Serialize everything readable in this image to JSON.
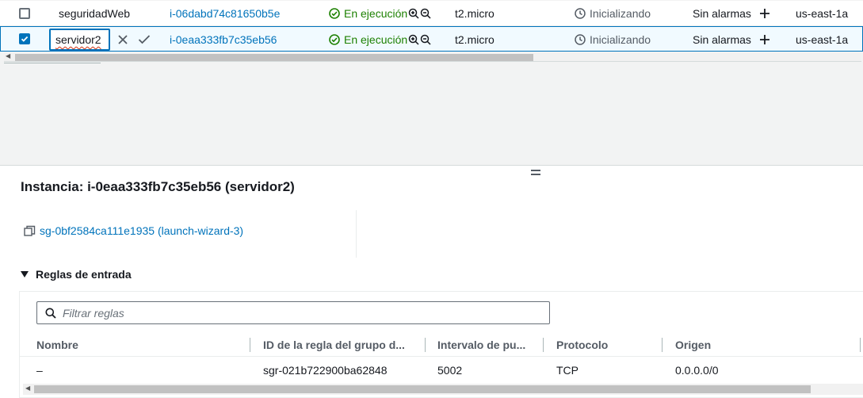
{
  "instances": [
    {
      "name": "seguridadWeb",
      "id": "i-06dabd74c81650b5e",
      "state": "En ejecución",
      "type": "t2.micro",
      "status_check": "Inicializando",
      "alarms": "Sin alarmas",
      "az": "us-east-1a",
      "selected": false
    },
    {
      "name": "servidor2",
      "id": "i-0eaa333fb7c35eb56",
      "state": "En ejecución",
      "type": "t2.micro",
      "status_check": "Inicializando",
      "alarms": "Sin alarmas",
      "az": "us-east-1a",
      "selected": true
    }
  ],
  "details": {
    "title": "Instancia: i-0eaa333fb7c35eb56 (servidor2)",
    "security_group_link": "sg-0bf2584ca111e1935 (launch-wizard-3)",
    "section_title": "Reglas de entrada",
    "filter_placeholder": "Filtrar reglas",
    "columns": [
      "Nombre",
      "ID de la regla del grupo d...",
      "Intervalo de pu...",
      "Protocolo",
      "Origen"
    ],
    "rows": [
      [
        "–",
        "sgr-021b722900ba62848",
        "5002",
        "TCP",
        "0.0.0.0/0"
      ]
    ]
  },
  "colors": {
    "link": "#0073bb",
    "running": "#1d8102",
    "selected_row_bg": "#f1faff"
  },
  "icons": [
    "checkbox-icon",
    "running-state-icon",
    "zoom-in-icon",
    "zoom-out-icon",
    "clock-icon",
    "plus-icon",
    "cancel-icon",
    "confirm-icon",
    "copy-icon",
    "caret-down-icon",
    "search-icon",
    "drag-handle-icon"
  ]
}
